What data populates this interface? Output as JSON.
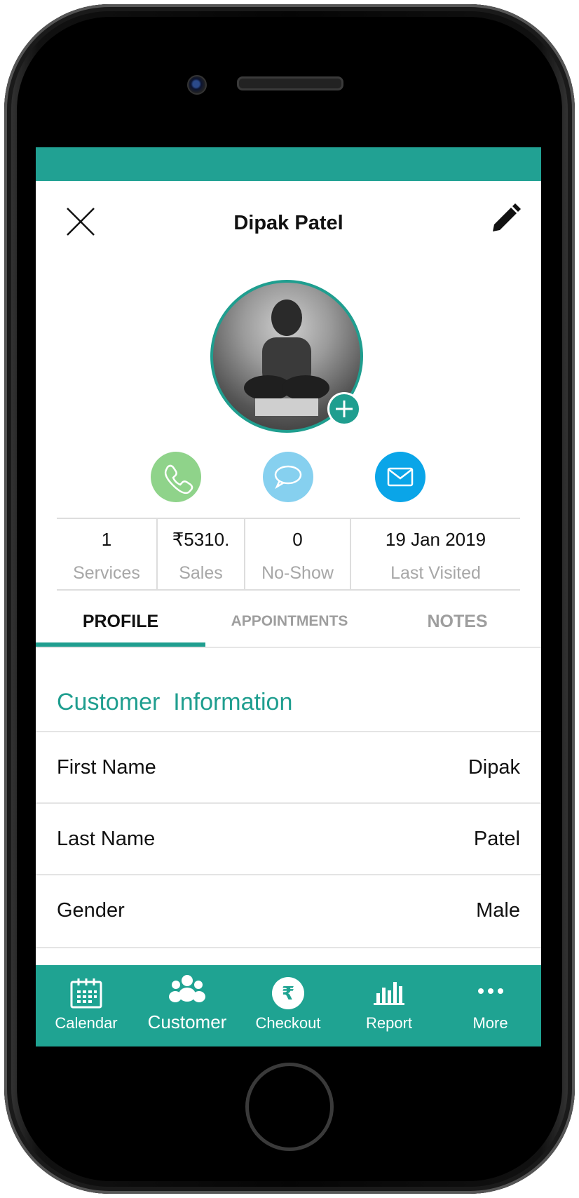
{
  "header": {
    "title": "Dipak Patel"
  },
  "stats": [
    {
      "value": "1",
      "label": "Services"
    },
    {
      "value": "₹5310.",
      "label": "Sales"
    },
    {
      "value": "0",
      "label": "No-Show"
    },
    {
      "value": "19 Jan 2019",
      "label": "Last Visited"
    }
  ],
  "tabs": [
    {
      "label": "PROFILE",
      "active": true
    },
    {
      "label": "APPOINTMENTS",
      "active": false
    },
    {
      "label": "NOTES",
      "active": false
    }
  ],
  "section": {
    "title": "Customer  Information"
  },
  "fields": [
    {
      "label": "First Name",
      "value": "Dipak"
    },
    {
      "label": "Last Name",
      "value": "Patel"
    },
    {
      "label": "Gender",
      "value": "Male"
    }
  ],
  "nav": [
    {
      "label": "Calendar",
      "icon": "calendar-icon"
    },
    {
      "label": "Customer",
      "icon": "customers-icon"
    },
    {
      "label": "Checkout",
      "icon": "rupee-icon"
    },
    {
      "label": "Report",
      "icon": "bar-chart-icon"
    },
    {
      "label": "More",
      "icon": "more-dots-icon"
    }
  ],
  "colors": {
    "accent": "#1f9e8f",
    "call": "#8fd38a",
    "message": "#86d0ef",
    "email": "#0aa5e8"
  }
}
